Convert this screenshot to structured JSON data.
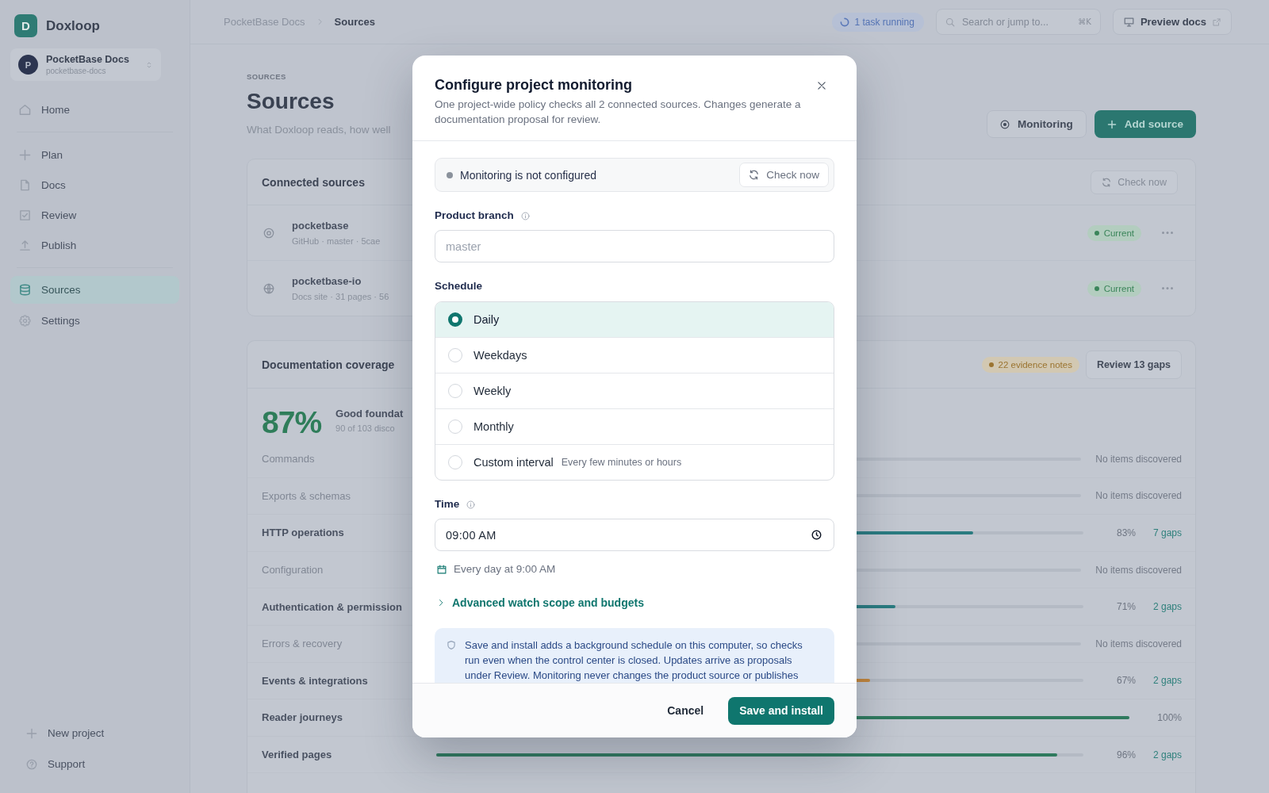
{
  "sidebar": {
    "logo_letter": "D",
    "app_name": "Doxloop",
    "project": {
      "initial": "P",
      "name": "PocketBase Docs",
      "slug": "pocketbase-docs"
    },
    "nav_groups": [
      {
        "items": [
          {
            "label": "Home",
            "selected": false
          }
        ]
      },
      {
        "items": [
          {
            "label": "Plan",
            "selected": false
          },
          {
            "label": "Docs",
            "selected": false
          },
          {
            "label": "Review",
            "selected": false
          },
          {
            "label": "Publish",
            "selected": false
          }
        ]
      },
      {
        "items": [
          {
            "label": "Sources",
            "selected": true
          },
          {
            "label": "Settings",
            "selected": false
          }
        ]
      }
    ],
    "footer_links": [
      "New project",
      "Support"
    ]
  },
  "topbar": {
    "breadcrumb": [
      "PocketBase Docs",
      "Sources"
    ],
    "task_status": "1 task running",
    "search": {
      "placeholder": "Search or jump to...",
      "shortcut": "⌘K"
    },
    "preview_button": "Preview docs"
  },
  "header": {
    "eyebrow": "SOURCES",
    "title": "Sources",
    "subtitle": "What Doxloop reads, how well",
    "actions": [
      {
        "label": "Monitoring",
        "kind": "secondary"
      },
      {
        "label": "Add source",
        "kind": "primary"
      }
    ]
  },
  "connected_sources": {
    "title": "Connected sources",
    "check_button": "Check now",
    "rows": [
      {
        "name": "pocketbase",
        "meta": "GitHub · master · 5cae",
        "status": "Current"
      },
      {
        "name": "pocketbase-io",
        "meta": "Docs site · 31 pages · 56",
        "status": "Current"
      }
    ]
  },
  "coverage": {
    "title": "Documentation coverage",
    "evidence_badge": "22 evidence notes",
    "review_button": "Review 13 gaps",
    "score": "87%",
    "summary_title": "Good foundat",
    "summary_detail": "90 of 103 disco",
    "rows": [
      {
        "name": "Commands",
        "kind": "empty",
        "note": "No items discovered"
      },
      {
        "name": "Exports & schemas",
        "kind": "empty",
        "note": "No items discovered"
      },
      {
        "name": "HTTP operations",
        "kind": "measured",
        "level": 0.83,
        "percent": "83%",
        "gaps": "7 gaps"
      },
      {
        "name": "Configuration",
        "kind": "empty",
        "note": "No items discovered"
      },
      {
        "name": "Authentication & permission",
        "kind": "measured",
        "level": 0.71,
        "percent": "71%",
        "gaps": "2 gaps"
      },
      {
        "name": "Errors & recovery",
        "kind": "empty",
        "note": "No items discovered"
      },
      {
        "name": "Events & integrations",
        "kind": "measured",
        "level": 0.67,
        "percent": "67%",
        "gaps": "2 gaps"
      },
      {
        "name": "Reader journeys",
        "kind": "measured",
        "level": 1,
        "percent": "100%"
      },
      {
        "name": "Verified pages",
        "kind": "measured",
        "level": 0.96,
        "percent": "96%",
        "gaps": "2 gaps"
      }
    ]
  },
  "modal": {
    "title": "Configure project monitoring",
    "description": "One project-wide policy checks all 2 connected sources. Changes generate a documentation proposal for review.",
    "status": {
      "text": "Monitoring is not configured",
      "configured": false,
      "button": "Check now"
    },
    "branch": {
      "label": "Product branch",
      "placeholder": "master"
    },
    "schedule": {
      "label": "Schedule",
      "options": [
        {
          "label": "Daily",
          "selected": true
        },
        {
          "label": "Weekdays",
          "selected": false
        },
        {
          "label": "Weekly",
          "selected": false
        },
        {
          "label": "Monthly",
          "selected": false
        },
        {
          "label": "Custom interval",
          "hint": "Every few minutes or hours",
          "selected": false
        }
      ]
    },
    "time": {
      "label": "Time",
      "value": "09:00 AM"
    },
    "summary": "Every day at 9:00 AM",
    "advanced": {
      "label": "Advanced watch scope and budgets",
      "expanded": false
    },
    "notice": "Save and install adds a background schedule on this computer, so checks run even when the control center is closed. Updates arrive as proposals under Review. Monitoring never changes the product source or publishes",
    "buttons": [
      {
        "label": "Cancel",
        "kind": "secondary"
      },
      {
        "label": "Save and install",
        "kind": "primary"
      }
    ]
  }
}
